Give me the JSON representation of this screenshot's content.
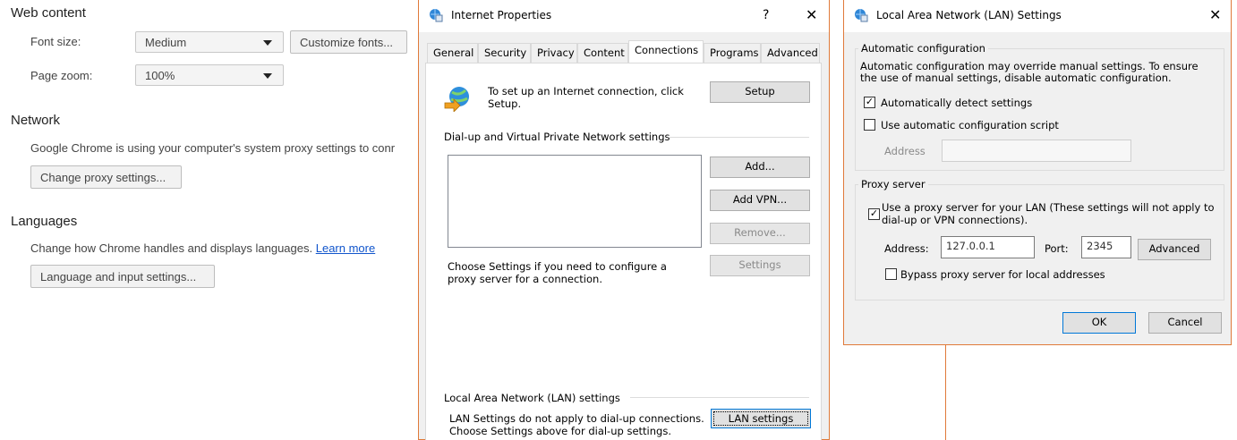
{
  "chrome_settings": {
    "web_content": {
      "title": "Web content",
      "font_size_label": "Font size:",
      "font_size_value": "Medium",
      "customize_fonts_button": "Customize fonts...",
      "page_zoom_label": "Page zoom:",
      "page_zoom_value": "100%"
    },
    "network": {
      "title": "Network",
      "description": "Google Chrome is using your computer's system proxy settings to conr",
      "change_proxy_button": "Change proxy settings..."
    },
    "languages": {
      "title": "Languages",
      "description": "Change how Chrome handles and displays languages.",
      "learn_more_link": "Learn more",
      "language_button": "Language and input settings..."
    }
  },
  "internet_properties": {
    "title": "Internet Properties",
    "help_glyph": "?",
    "close_glyph": "✕",
    "tabs": [
      "General",
      "Security",
      "Privacy",
      "Content",
      "Connections",
      "Programs",
      "Advanced"
    ],
    "active_tab": "Connections",
    "setup_text": "To set up an Internet connection, click Setup.",
    "setup_button": "Setup",
    "dialup_group_label": "Dial-up and Virtual Private Network settings",
    "add_button": "Add...",
    "add_vpn_button": "Add VPN...",
    "remove_button": "Remove...",
    "settings_text": "Choose Settings if you need to configure a proxy server for a connection.",
    "settings_button": "Settings",
    "lan_group_label": "Local Area Network (LAN) settings",
    "lan_text_line1": "LAN Settings do not apply to dial-up connections.",
    "lan_text_line2": "Choose Settings above for dial-up settings.",
    "lan_settings_button": "LAN settings"
  },
  "lan_settings": {
    "title": "Local Area Network (LAN) Settings",
    "close_glyph": "✕",
    "auto_config_group": "Automatic configuration",
    "auto_config_desc": "Automatic configuration may override manual settings.  To ensure the use of manual settings, disable automatic configuration.",
    "auto_detect_label": "Automatically detect settings",
    "auto_detect_checked": true,
    "auto_script_label": "Use automatic configuration script",
    "auto_script_checked": false,
    "script_address_label": "Address",
    "script_address_value": "",
    "proxy_group": "Proxy server",
    "use_proxy_label": "Use a proxy server for your LAN (These settings will not apply to dial-up or VPN connections).",
    "use_proxy_checked": true,
    "proxy_address_label": "Address:",
    "proxy_address_value": "127.0.0.1",
    "port_label": "Port:",
    "port_value": "2345",
    "advanced_button": "Advanced",
    "bypass_label": "Bypass proxy server for local addresses",
    "bypass_checked": false,
    "ok_button": "OK",
    "cancel_button": "Cancel"
  },
  "colors": {
    "dialog_border": "#e07a3a",
    "link": "#1155cc",
    "default_button_border": "#0078d7"
  }
}
